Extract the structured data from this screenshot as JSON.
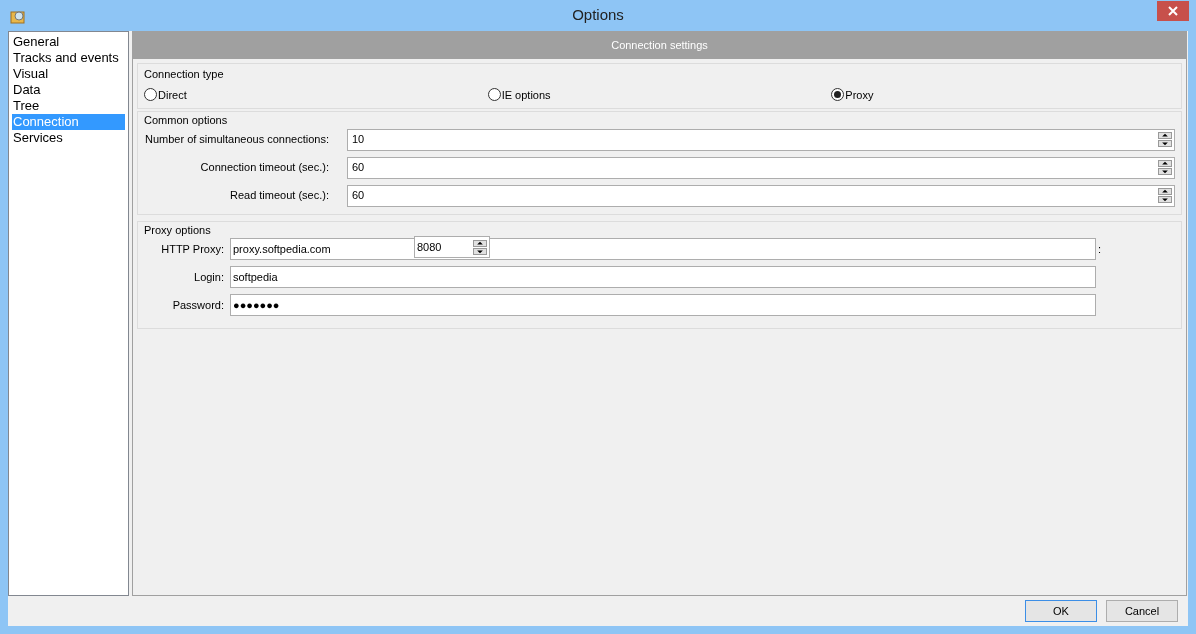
{
  "window": {
    "title": "Options"
  },
  "sidebar": {
    "items": [
      {
        "label": "General",
        "selected": false
      },
      {
        "label": "Tracks and events",
        "selected": false
      },
      {
        "label": "Visual",
        "selected": false
      },
      {
        "label": "Data",
        "selected": false
      },
      {
        "label": "Tree",
        "selected": false
      },
      {
        "label": "Connection",
        "selected": true
      },
      {
        "label": "Services",
        "selected": false
      }
    ]
  },
  "header": "Connection settings",
  "connection_type": {
    "legend": "Connection type",
    "options": [
      {
        "label": "Direct",
        "selected": false
      },
      {
        "label": "IE options",
        "selected": false
      },
      {
        "label": "Proxy",
        "selected": true
      }
    ]
  },
  "common_options": {
    "legend": "Common options",
    "fields": [
      {
        "label": "Number of simultaneous connections:",
        "value": "10"
      },
      {
        "label": "Connection timeout (sec.):",
        "value": "60"
      },
      {
        "label": "Read timeout (sec.):",
        "value": "60"
      }
    ]
  },
  "proxy_options": {
    "legend": "Proxy options",
    "http_proxy": {
      "label": "HTTP Proxy:",
      "host": "proxy.softpedia.com",
      "port": "8080",
      "separator": ":"
    },
    "login": {
      "label": "Login:",
      "value": "softpedia"
    },
    "password": {
      "label": "Password:",
      "value": "●●●●●●●"
    }
  },
  "buttons": [
    {
      "label": "OK",
      "default": true
    },
    {
      "label": "Cancel",
      "default": false
    }
  ]
}
